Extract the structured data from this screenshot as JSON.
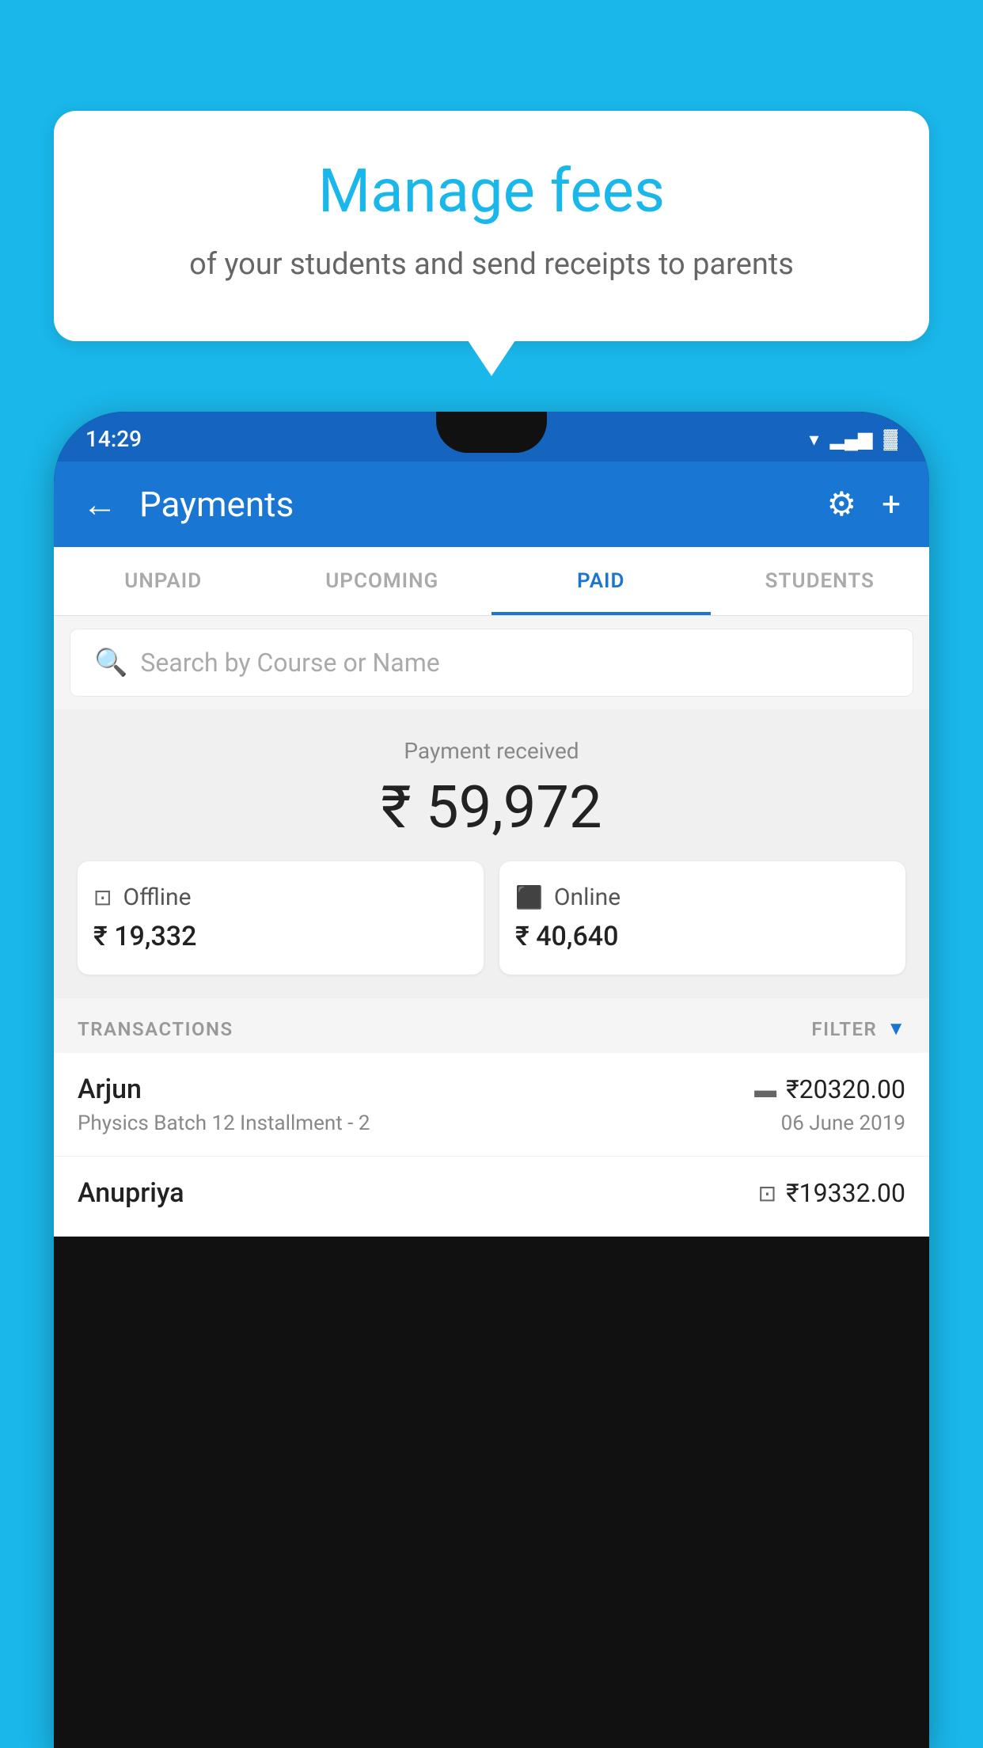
{
  "background_color": "#1ab7ea",
  "tooltip": {
    "title": "Manage fees",
    "subtitle": "of your students and send receipts to parents"
  },
  "phone": {
    "status_bar": {
      "time": "14:29"
    },
    "header": {
      "title": "Payments",
      "back_label": "←",
      "settings_label": "⚙",
      "add_label": "+"
    },
    "tabs": [
      {
        "label": "UNPAID",
        "active": false
      },
      {
        "label": "UPCOMING",
        "active": false
      },
      {
        "label": "PAID",
        "active": true
      },
      {
        "label": "STUDENTS",
        "active": false
      }
    ],
    "search": {
      "placeholder": "Search by Course or Name"
    },
    "payment_summary": {
      "received_label": "Payment received",
      "amount": "₹ 59,972",
      "offline": {
        "label": "Offline",
        "amount": "₹ 19,332"
      },
      "online": {
        "label": "Online",
        "amount": "₹ 40,640"
      }
    },
    "transactions": {
      "header_label": "TRANSACTIONS",
      "filter_label": "FILTER",
      "rows": [
        {
          "name": "Arjun",
          "amount": "₹20320.00",
          "type_icon": "card",
          "course": "Physics Batch 12 Installment - 2",
          "date": "06 June 2019"
        },
        {
          "name": "Anupriya",
          "amount": "₹19332.00",
          "type_icon": "cash",
          "course": "",
          "date": ""
        }
      ]
    }
  }
}
